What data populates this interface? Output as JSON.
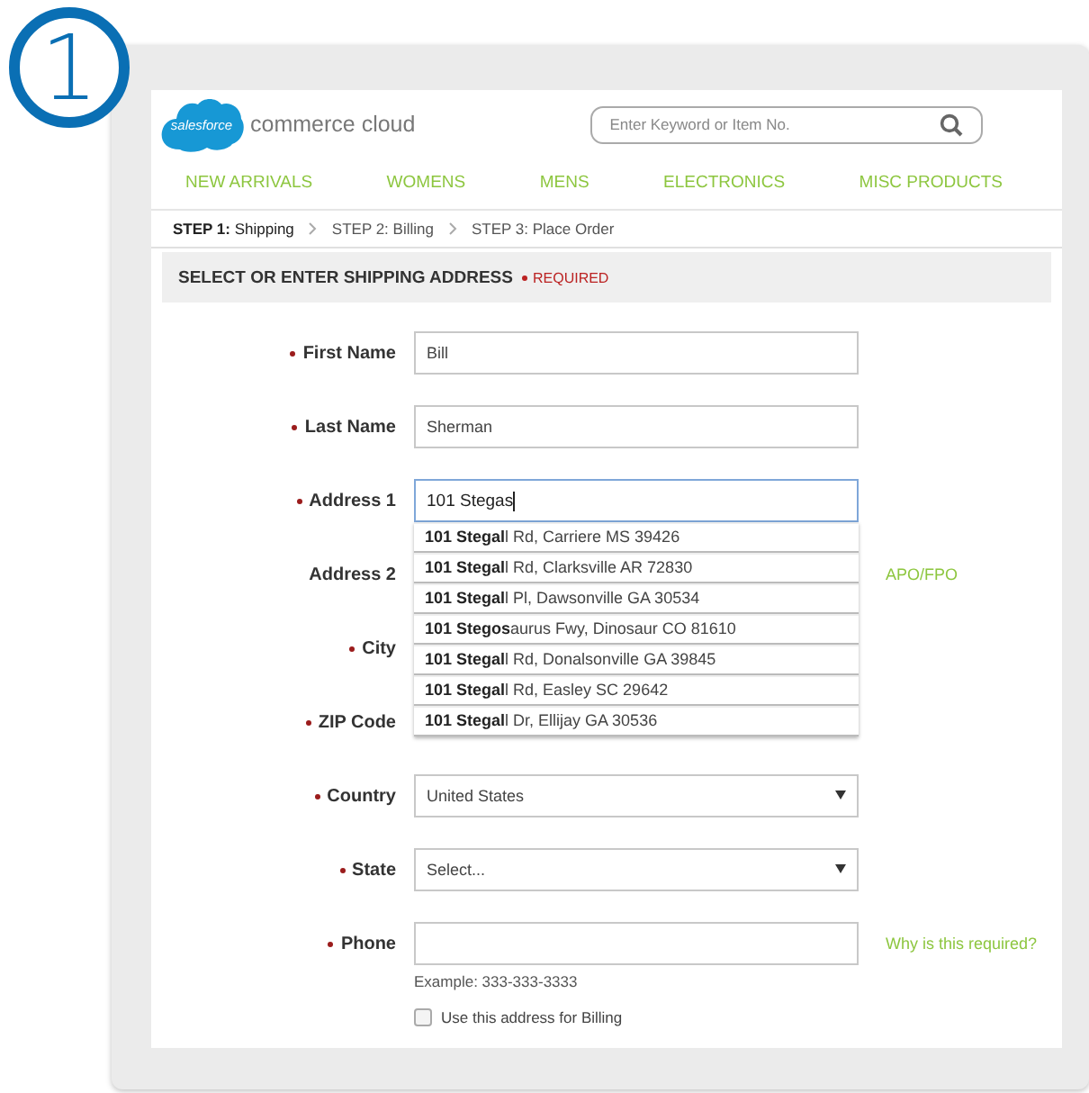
{
  "badge": "1",
  "logo": {
    "mark": "salesforce",
    "product": "commerce cloud"
  },
  "search": {
    "placeholder": "Enter Keyword or Item No."
  },
  "nav": [
    "NEW ARRIVALS",
    "WOMENS",
    "MENS",
    "ELECTRONICS",
    "MISC PRODUCTS"
  ],
  "steps": [
    {
      "label": "**STEP 1:** Shipping",
      "selected": true
    },
    {
      "label": "STEP 2: Billing",
      "selected": false
    },
    {
      "label": "STEP 3: Place Order",
      "selected": false
    }
  ],
  "section": {
    "title": "SELECT OR ENTER SHIPPING ADDRESS",
    "required": "REQUIRED"
  },
  "fields": [
    {
      "label": "First Name",
      "required": true,
      "kind": "text",
      "value": "Bill"
    },
    {
      "label": "Last Name",
      "required": true,
      "kind": "text",
      "value": "Sherman"
    },
    {
      "label": "Address 1",
      "required": true,
      "kind": "text",
      "value": "101 Stegas",
      "focused": true,
      "suggestions": [
        "**101 Stegal**l Rd, Carriere MS 39426",
        "**101 Stegal**l Rd, Clarksville AR 72830",
        "**101 Stegal**l Pl, Dawsonville GA 30534",
        "**101 Stegos**aurus Fwy, Dinosaur CO 81610",
        "**101 Stegal**l Rd, Donalsonville GA 39845",
        "**101 Stegal**l Rd, Easley SC 29642",
        "**101 Stegal**l Dr, Ellijay GA 30536"
      ]
    },
    {
      "label": "Address 2",
      "required": false,
      "kind": "covered",
      "link": "APO/FPO"
    },
    {
      "label": "City",
      "required": true,
      "kind": "covered"
    },
    {
      "label": "ZIP Code",
      "required": true,
      "kind": "covered"
    },
    {
      "label": "Country",
      "required": true,
      "kind": "select",
      "value": "United States"
    },
    {
      "label": "State",
      "required": true,
      "kind": "select",
      "value": "Select..."
    },
    {
      "label": "Phone",
      "required": true,
      "kind": "text",
      "link": "Why is this required?",
      "hint": "Example: 333-333-3333"
    }
  ],
  "billing": {
    "label": "Use this address for Billing",
    "checked": false
  }
}
